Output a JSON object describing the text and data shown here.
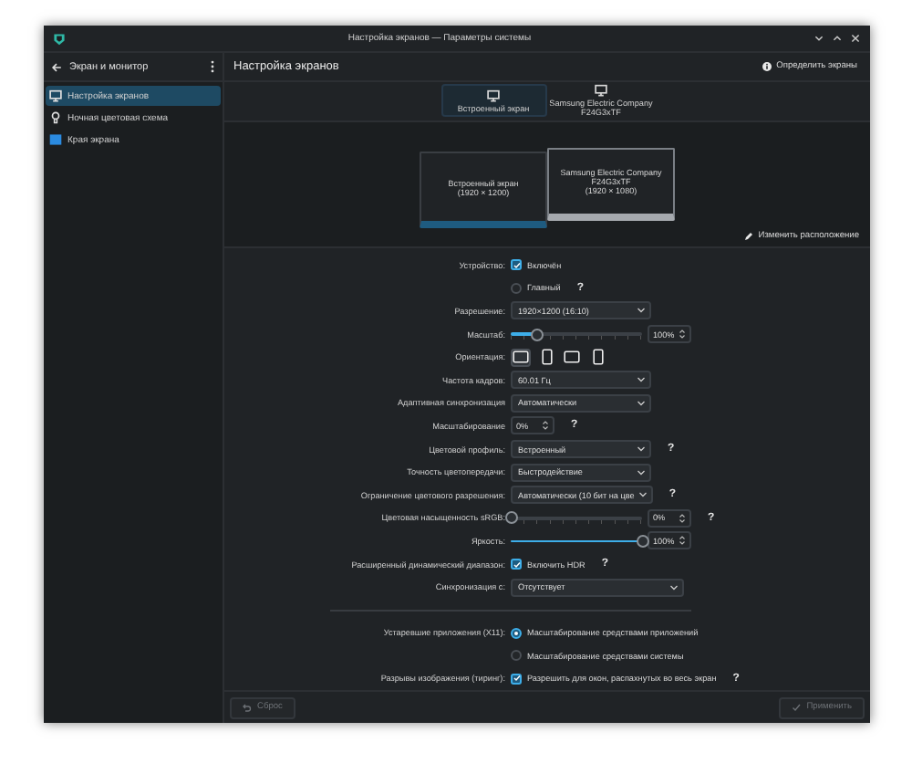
{
  "window": {
    "title": "Настройка экранов — Параметры системы"
  },
  "sidebar": {
    "title": "Экран и монитор",
    "items": [
      {
        "label": "Настройка экранов",
        "selected": true,
        "kind": "monitor"
      },
      {
        "label": "Ночная цветовая схема",
        "selected": false,
        "kind": "lamp"
      },
      {
        "label": "Края экрана",
        "selected": false,
        "kind": "edges"
      }
    ]
  },
  "header": {
    "title": "Настройка экранов",
    "identify_button": "Определить экраны"
  },
  "tabs": [
    {
      "label": "Встроенный экран",
      "selected": true
    },
    {
      "label": "Samsung Electric Company\nF24G3xTF",
      "selected": false
    }
  ],
  "monitors": [
    {
      "name": "Встроенный экран",
      "resolution": "(1920 × 1200)",
      "selected": true
    },
    {
      "name": "Samsung Electric Company\nF24G3xTF",
      "resolution": "(1920 × 1080)",
      "selected": false
    }
  ],
  "rearrange_button": "Изменить расположение",
  "settings": [
    {
      "label": "Устройство:",
      "kind": "checkbox",
      "text": "Включён",
      "checked": true
    },
    {
      "kind": "radio",
      "text": "Главный",
      "selected": false,
      "help": "?"
    },
    {
      "label": "Разрешение:",
      "kind": "combo",
      "value": "1920×1200 (16:10)"
    },
    {
      "label": "Масштаб:",
      "kind": "slider",
      "level": 0.2,
      "value": "100%"
    },
    {
      "label": "Ориентация:",
      "kind": "orientation",
      "options": [
        {
          "selected": true
        },
        {
          "selected": false
        },
        {
          "selected": false
        },
        {
          "selected": false
        }
      ]
    },
    {
      "label": "Частота кадров:",
      "kind": "combo",
      "value": "60.01 Гц"
    },
    {
      "label": "Адаптивная синхронизация",
      "kind": "combo",
      "value": "Автоматически"
    },
    {
      "label": "Масштабирование",
      "kind": "spin",
      "value": "0%",
      "help": "?"
    },
    {
      "label": "Цветовой профиль:",
      "kind": "combo",
      "value": "Встроенный",
      "help": "?"
    },
    {
      "label": "Точность цветопередачи:",
      "kind": "combo",
      "value": "Быстродействие"
    },
    {
      "label": "Ограничение цветового разрешения:",
      "kind": "combo",
      "value": "Автоматически (10 бит на цве",
      "help": "?"
    },
    {
      "label": "Цветовая насыщенность sRGB:",
      "kind": "slider",
      "level": 0,
      "value": "0%",
      "help": "?"
    },
    {
      "label": "Яркость:",
      "kind": "slider",
      "level": 1,
      "value": "100%"
    },
    {
      "label": "Расширенный динамический диапазон:",
      "kind": "checkbox",
      "text": "Включить HDR",
      "checked": true,
      "help": "?"
    },
    {
      "label": "Синхронизация с:",
      "kind": "combo",
      "value": "Отсутствует"
    },
    {
      "kind": "divider"
    },
    {
      "label": "Устаревшие приложения (X11):",
      "kind": "radio",
      "text": "Масштабирование средствами приложений",
      "selected": true
    },
    {
      "kind": "radio",
      "text": "Масштабирование средствами системы",
      "selected": false
    },
    {
      "label": "Разрывы изображения (тиринг):",
      "kind": "checkbox",
      "text": "Разрешить для окон, распахнутых во весь экран",
      "checked": true,
      "help": "?"
    }
  ],
  "footer": {
    "reset_button": {
      "label": "Сброс",
      "disabled": true
    },
    "apply_button": {
      "label": "Применить",
      "disabled": true
    }
  }
}
